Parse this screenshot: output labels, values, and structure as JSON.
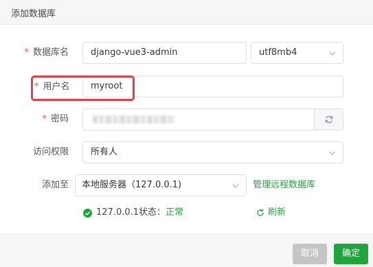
{
  "dialog": {
    "title": "添加数据库",
    "cancel_label": "取消",
    "confirm_label": "确定"
  },
  "form": {
    "db_name": {
      "label": "数据库名",
      "value": "django-vue3-admin",
      "required": true
    },
    "charset": {
      "value": "utf8mb4"
    },
    "username": {
      "label": "用户名",
      "value": "myroot",
      "required": true
    },
    "password": {
      "label": "密码",
      "required": true,
      "masked": true
    },
    "access": {
      "label": "访问权限",
      "value": "所有人"
    },
    "add_to": {
      "label": "添加至",
      "value": "本地服务器（127.0.0.1)",
      "manage_link": "管理远程数据库"
    },
    "required_mark": "*"
  },
  "status": {
    "host_text": "127.0.0.1状态：",
    "state": "正常",
    "refresh_label": "刷新"
  },
  "colors": {
    "accent_green": "#20a53a",
    "highlight_red": "#e23d48",
    "required_red": "#e05353",
    "cancel_gray": "#c5c5c5"
  },
  "icons": {
    "password_refresh": "refresh-icon",
    "status": "check-circle-icon",
    "refresh": "refresh-icon",
    "dropdown": "chevron-down-icon"
  }
}
